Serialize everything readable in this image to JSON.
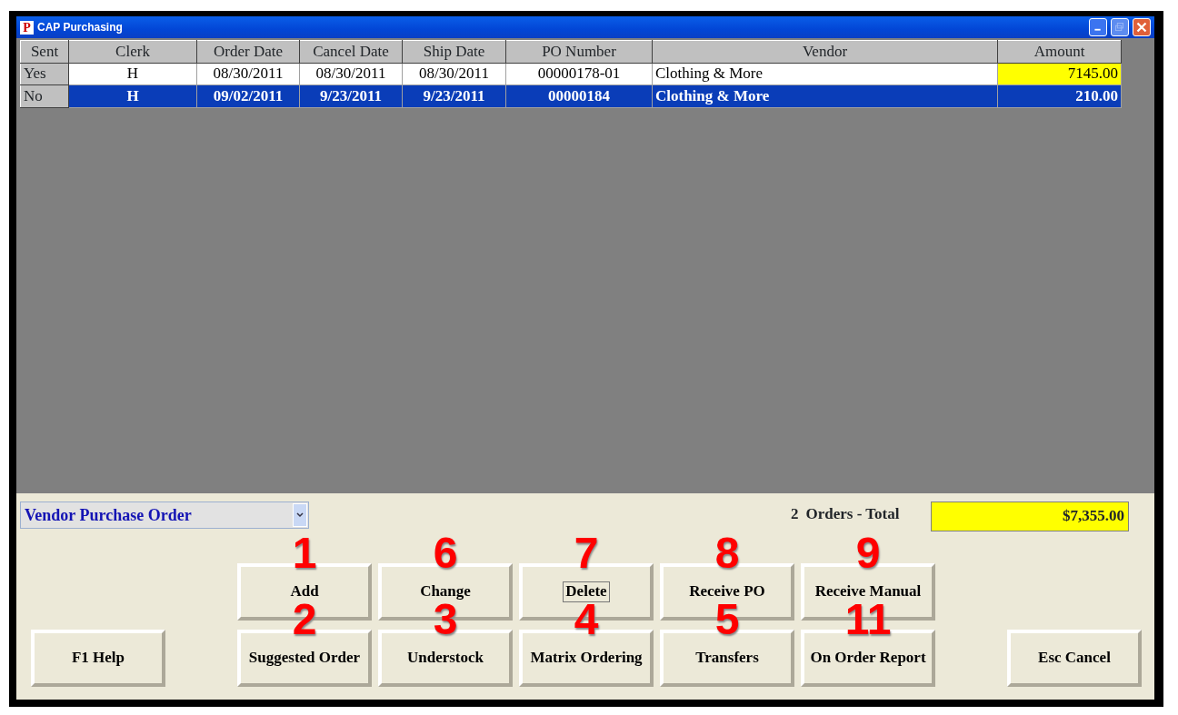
{
  "window": {
    "title": "CAP Purchasing",
    "logo": "P"
  },
  "table": {
    "columns": [
      "Sent",
      "Clerk",
      "Order Date",
      "Cancel Date",
      "Ship Date",
      "PO Number",
      "Vendor",
      "Amount"
    ],
    "rows": [
      {
        "selected": false,
        "amount_highlight": true,
        "cells": [
          "Yes",
          "H",
          "08/30/2011",
          "08/30/2011",
          "08/30/2011",
          "00000178-01",
          "Clothing & More",
          "7145.00"
        ]
      },
      {
        "selected": true,
        "amount_highlight": false,
        "cells": [
          "No",
          "H",
          "09/02/2011",
          "9/23/2011",
          "9/23/2011",
          "00000184",
          "Clothing & More",
          "210.00"
        ]
      }
    ]
  },
  "order_type": {
    "value": "Vendor Purchase Order"
  },
  "summary": {
    "count": "2",
    "label": "Orders - Total",
    "total": "$7,355.00"
  },
  "button_rows": [
    [
      {
        "label": "Add",
        "callout": "1",
        "focused": false
      },
      {
        "label": "Change",
        "callout": "6",
        "focused": false
      },
      {
        "label": "Delete",
        "callout": "7",
        "focused": true
      },
      {
        "label": "Receive PO",
        "callout": "8",
        "focused": false
      },
      {
        "label": "Receive Manual",
        "callout": "9",
        "focused": false
      }
    ],
    [
      {
        "label": "F1 Help",
        "focused": false
      },
      {
        "label": "Suggested Order",
        "callout": "2",
        "focused": false
      },
      {
        "label": "Understock",
        "callout": "3",
        "focused": false
      },
      {
        "label": "Matrix Ordering",
        "callout": "4",
        "focused": false
      },
      {
        "label": "Transfers",
        "callout": "5",
        "focused": false
      },
      {
        "label": "On Order Report",
        "callout": "11",
        "focused": false
      },
      {
        "label": "Esc Cancel",
        "focused": false
      }
    ]
  ]
}
